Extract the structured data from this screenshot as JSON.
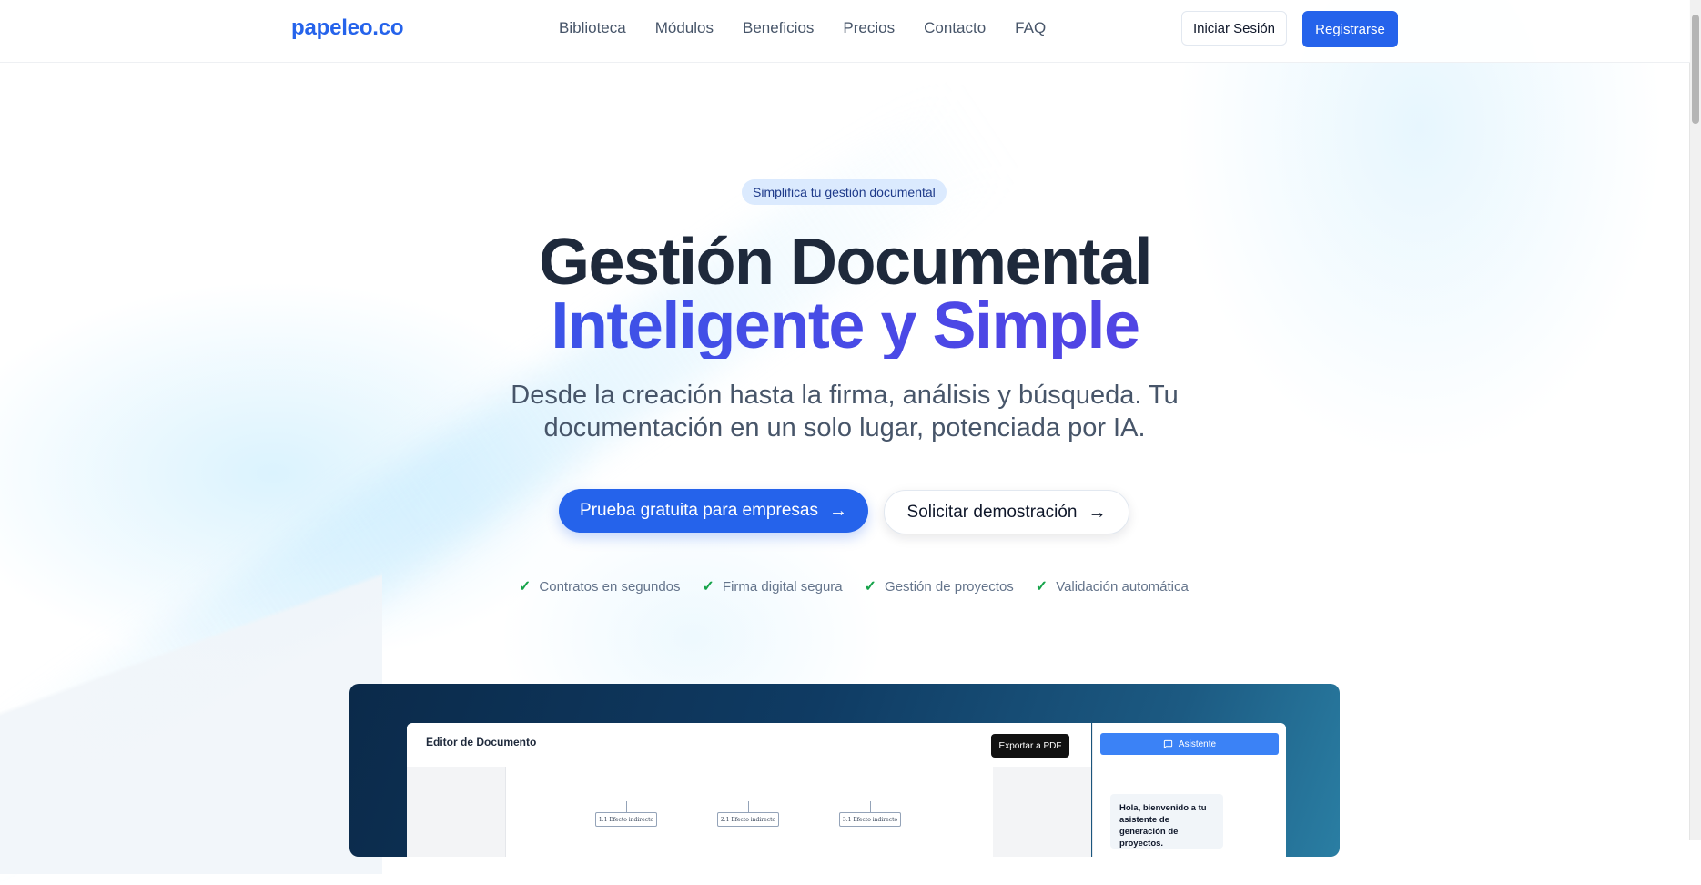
{
  "brand": {
    "logo_text": "papeleo.co",
    "accent_color": "#2563eb"
  },
  "nav": {
    "links": [
      "Biblioteca",
      "Módulos",
      "Beneficios",
      "Precios",
      "Contacto",
      "FAQ"
    ],
    "login_label": "Iniciar Sesión",
    "register_label": "Registrarse"
  },
  "hero": {
    "badge": "Simplifica tu gestión documental",
    "title_line1": "Gestión Documental",
    "title_line2": "Inteligente y Simple",
    "subtitle": "Desde la creación hasta la firma, análisis y búsqueda. Tu documentación en un solo lugar, potenciada por IA.",
    "cta_primary": "Prueba gratuita para empresas",
    "cta_secondary": "Solicitar demostración",
    "features": [
      "Contratos en segundos",
      "Firma digital segura",
      "Gestión de proyectos",
      "Validación automática"
    ]
  },
  "preview": {
    "editor_title": "Editor de Documento",
    "export_label": "Exportar a PDF",
    "nodes": [
      "1.1 Efecto indirecto",
      "2.1 Efecto indirecto",
      "3.1 Efecto indirecto"
    ],
    "assistant_label": "Asistente",
    "assistant_message": "Hola, bienvenido a tu asistente de generación de proyectos."
  },
  "icons": {
    "arrow": "arrow-right-icon",
    "check": "check-icon",
    "chat": "message-square-icon"
  }
}
